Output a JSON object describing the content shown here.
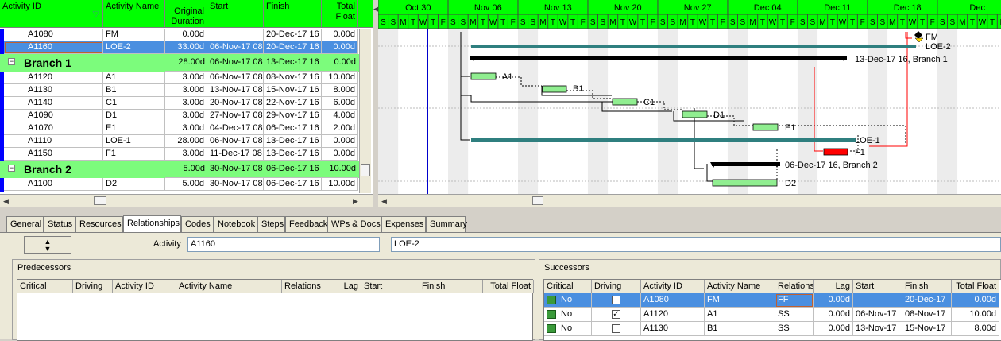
{
  "table": {
    "columns": [
      "Activity ID",
      "Activity Name",
      "Original Duration",
      "Start",
      "Finish",
      "Total Float"
    ],
    "rows": [
      {
        "type": "act",
        "id": "A1080",
        "name": "FM",
        "dur": "0.00d",
        "start": "",
        "finish": "20-Dec-17 16",
        "float": "0.00d"
      },
      {
        "type": "act",
        "id": "A1160",
        "name": "LOE-2",
        "dur": "33.00d",
        "start": "06-Nov-17 08",
        "finish": "20-Dec-17 16",
        "float": "0.00d",
        "selected": true
      },
      {
        "type": "grp",
        "name": "Branch 1",
        "dur": "28.00d",
        "start": "06-Nov-17 08",
        "finish": "13-Dec-17 16",
        "float": "0.00d"
      },
      {
        "type": "act",
        "id": "A1120",
        "name": "A1",
        "dur": "3.00d",
        "start": "06-Nov-17 08",
        "finish": "08-Nov-17 16",
        "float": "10.00d"
      },
      {
        "type": "act",
        "id": "A1130",
        "name": "B1",
        "dur": "3.00d",
        "start": "13-Nov-17 08",
        "finish": "15-Nov-17 16",
        "float": "8.00d"
      },
      {
        "type": "act",
        "id": "A1140",
        "name": "C1",
        "dur": "3.00d",
        "start": "20-Nov-17 08",
        "finish": "22-Nov-17 16",
        "float": "6.00d"
      },
      {
        "type": "act",
        "id": "A1090",
        "name": "D1",
        "dur": "3.00d",
        "start": "27-Nov-17 08",
        "finish": "29-Nov-17 16",
        "float": "4.00d"
      },
      {
        "type": "act",
        "id": "A1070",
        "name": "E1",
        "dur": "3.00d",
        "start": "04-Dec-17 08",
        "finish": "06-Dec-17 16",
        "float": "2.00d"
      },
      {
        "type": "act",
        "id": "A1110",
        "name": "LOE-1",
        "dur": "28.00d",
        "start": "06-Nov-17 08",
        "finish": "13-Dec-17 16",
        "float": "0.00d"
      },
      {
        "type": "act",
        "id": "A1150",
        "name": "F1",
        "dur": "3.00d",
        "start": "11-Dec-17 08",
        "finish": "13-Dec-17 16",
        "float": "0.00d"
      },
      {
        "type": "grp",
        "name": "Branch 2",
        "dur": "5.00d",
        "start": "30-Nov-17 08",
        "finish": "06-Dec-17 16",
        "float": "10.00d"
      },
      {
        "type": "act",
        "id": "A1100",
        "name": "D2",
        "dur": "5.00d",
        "start": "30-Nov-17 08",
        "finish": "06-Dec-17 16",
        "float": "10.00d"
      }
    ]
  },
  "gantt": {
    "weeks": [
      "Oct 30",
      "Nov 06",
      "Nov 13",
      "Nov 20",
      "Nov 27",
      "Dec 04",
      "Dec 11",
      "Dec 18",
      "Dec"
    ],
    "day_letters": "SSMTWTFSSMTWTFSSMTWTFSSMTWTFSSMTWTFSSMTWTFSSMTWTFSSMTWTFSSMTWTFSS",
    "labels": {
      "fm": "FM",
      "loe2": "LOE-2",
      "branch1": "13-Dec-17 16, Branch 1",
      "a1": "A1",
      "b1": "B1",
      "c1": "C1",
      "d1": "D1",
      "e1": "E1",
      "loe1": "LOE-1",
      "f1": "F1",
      "branch2": "06-Dec-17 16, Branch 2",
      "d2": "D2"
    },
    "colors": {
      "header": "#00ff00",
      "bar": "#90ee90",
      "loe": "#2f7f7f",
      "critical": "#ff0000",
      "summary": "#000000",
      "link": "#000000",
      "data_date": "#0000cc"
    }
  },
  "tabs": [
    "General",
    "Status",
    "Resources",
    "Relationships",
    "Codes",
    "Notebook",
    "Steps",
    "Feedback",
    "WPs & Docs",
    "Expenses",
    "Summary"
  ],
  "active_tab": "Relationships",
  "detail": {
    "activity_label": "Activity",
    "activity_id": "A1160",
    "activity_name": "LOE-2",
    "pred_title": "Predecessors",
    "succ_title": "Successors",
    "pred_cols": [
      "Critical",
      "Driving",
      "Activity ID",
      "Activity Name",
      "Relations",
      "Lag",
      "Start",
      "Finish",
      "Total Float"
    ],
    "succ_cols": [
      "Critical",
      "Driving",
      "Activity ID",
      "Activity Name",
      "Relations",
      "Lag",
      "Start",
      "Finish",
      "Total Float"
    ],
    "successors": [
      {
        "critical": "No",
        "driving": true,
        "id": "A1080",
        "name": "FM",
        "rel": "FF",
        "lag": "0.00d",
        "start": "",
        "finish": "20-Dec-17",
        "float": "0.00d",
        "selected": true
      },
      {
        "critical": "No",
        "driving": true,
        "id": "A1120",
        "name": "A1",
        "rel": "SS",
        "lag": "0.00d",
        "start": "06-Nov-17",
        "finish": "08-Nov-17",
        "float": "10.00d"
      },
      {
        "critical": "No",
        "driving": false,
        "id": "A1130",
        "name": "B1",
        "rel": "SS",
        "lag": "0.00d",
        "start": "13-Nov-17",
        "finish": "15-Nov-17",
        "float": "8.00d"
      }
    ]
  }
}
